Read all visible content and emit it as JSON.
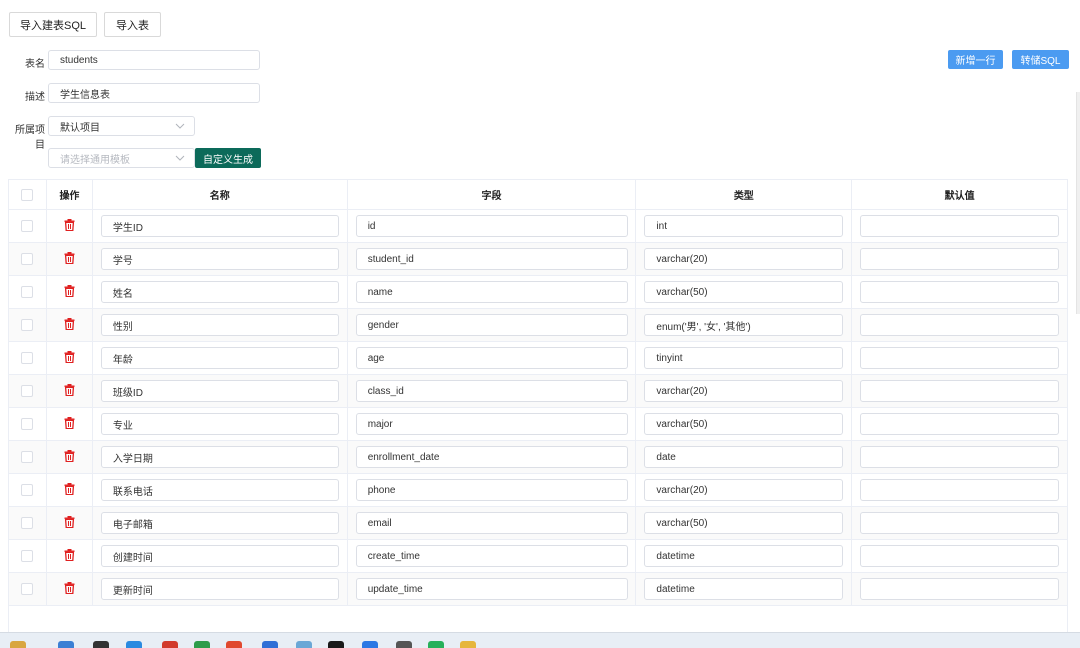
{
  "toolbar": {
    "import_sql": "导入建表SQL",
    "import_table": "导入表",
    "add_row": "新增一行",
    "to_sql": "转储SQL"
  },
  "form": {
    "table_name_label": "表名",
    "table_name_value": "students",
    "desc_label": "描述",
    "desc_value": "学生信息表",
    "project_label": "所属项目",
    "project_value": "默认项目",
    "template_placeholder": "请选择通用模板",
    "custom_generate": "自定义生成"
  },
  "table": {
    "headers": {
      "op": "操作",
      "name": "名称",
      "field": "字段",
      "type": "类型",
      "default": "默认值"
    },
    "rows": [
      {
        "name": "学生ID",
        "field": "id",
        "type": "int",
        "default": ""
      },
      {
        "name": "学号",
        "field": "student_id",
        "type": "varchar(20)",
        "default": ""
      },
      {
        "name": "姓名",
        "field": "name",
        "type": "varchar(50)",
        "default": ""
      },
      {
        "name": "性别",
        "field": "gender",
        "type": "enum('男', '女', '其他')",
        "default": ""
      },
      {
        "name": "年龄",
        "field": "age",
        "type": "tinyint",
        "default": ""
      },
      {
        "name": "班级ID",
        "field": "class_id",
        "type": "varchar(20)",
        "default": ""
      },
      {
        "name": "专业",
        "field": "major",
        "type": "varchar(50)",
        "default": ""
      },
      {
        "name": "入学日期",
        "field": "enrollment_date",
        "type": "date",
        "default": ""
      },
      {
        "name": "联系电话",
        "field": "phone",
        "type": "varchar(20)",
        "default": ""
      },
      {
        "name": "电子邮箱",
        "field": "email",
        "type": "varchar(50)",
        "default": ""
      },
      {
        "name": "创建时间",
        "field": "create_time",
        "type": "datetime",
        "default": ""
      },
      {
        "name": "更新时间",
        "field": "update_time",
        "type": "datetime",
        "default": ""
      }
    ]
  },
  "colors": {
    "primary_blue": "#4b9bf1",
    "green": "#0c6a5a",
    "delete_red": "#e02020"
  },
  "taskbar": {
    "icons": [
      "app-icon-1",
      "app-icon-2",
      "app-icon-3",
      "app-icon-4",
      "app-icon-5",
      "app-icon-6",
      "app-icon-7",
      "app-icon-8",
      "app-icon-9",
      "app-icon-10",
      "app-icon-11",
      "app-icon-12",
      "app-icon-13",
      "app-icon-14"
    ]
  }
}
